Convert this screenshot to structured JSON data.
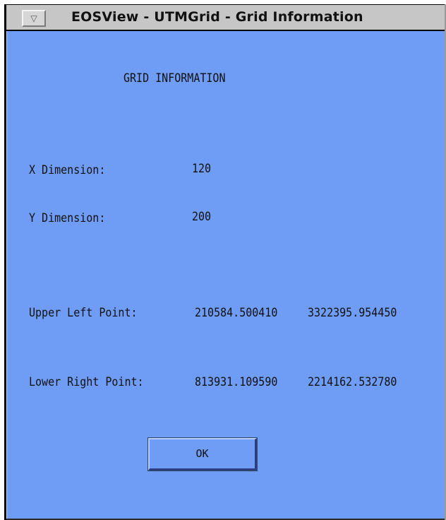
{
  "window": {
    "title": "EOSView - UTMGrid - Grid Information",
    "menu_glyph": "▽"
  },
  "dialog": {
    "heading": "GRID INFORMATION",
    "x_dimension_label": "X Dimension:",
    "x_dimension_value": "120",
    "y_dimension_label": "Y Dimension:",
    "y_dimension_value": "200",
    "upper_left_label": "Upper Left Point:",
    "upper_left_x": "210584.500410",
    "upper_left_y": "3322395.954450",
    "lower_right_label": "Lower Right Point:",
    "lower_right_x": "813931.109590",
    "lower_right_y": "2214162.532780",
    "ok_label": "OK"
  },
  "colors": {
    "background": "#6f9df5",
    "titlebar": "#c6c6c6"
  }
}
